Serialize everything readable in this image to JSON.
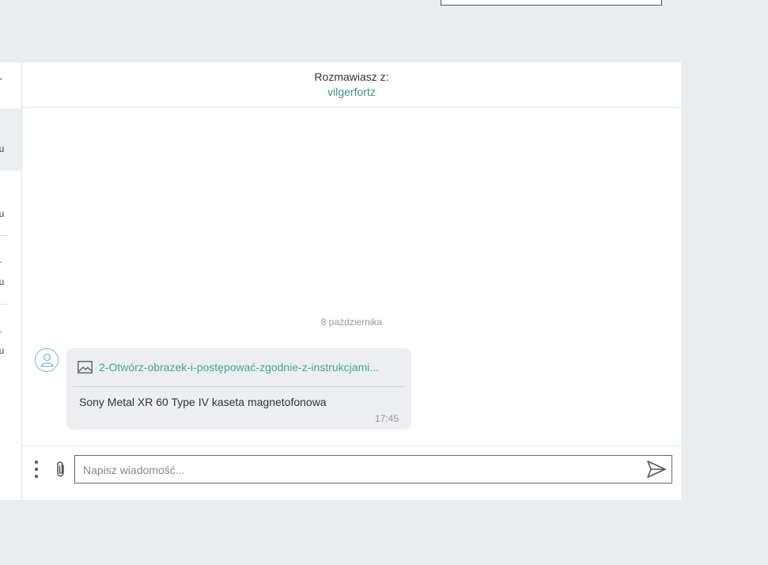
{
  "sidebar": {
    "items": [
      {
        "snippet": "",
        "time": "nu"
      },
      {
        "snippet": "",
        "time": "nu"
      },
      {
        "snippet": "..",
        "time": "nu"
      },
      {
        "snippet": "..",
        "time": "nu"
      }
    ]
  },
  "chat": {
    "header_label": "Rozmawiasz z:",
    "partner": "vilgerfortz",
    "date_separator": "8 października",
    "message": {
      "attachment_name": "2-Otwórz-obrazek-i-postępować-zgodnie-z-instrukcjami...",
      "text": "Sony Metal XR 60 Type IV kaseta magnetofonowa",
      "time": "17:45"
    }
  },
  "composer": {
    "placeholder": "Napisz wiadomość..."
  },
  "icons": {
    "avatar": "user-icon",
    "attachment": "image-icon",
    "menu": "kebab-menu-icon",
    "attach": "paperclip-icon",
    "send": "send-icon"
  },
  "colors": {
    "accent": "#3d8f86",
    "link": "#3fa699",
    "avatar_border": "#7ab8d6",
    "bubble_bg": "#eceef1",
    "page_bg": "#e9edf0"
  }
}
